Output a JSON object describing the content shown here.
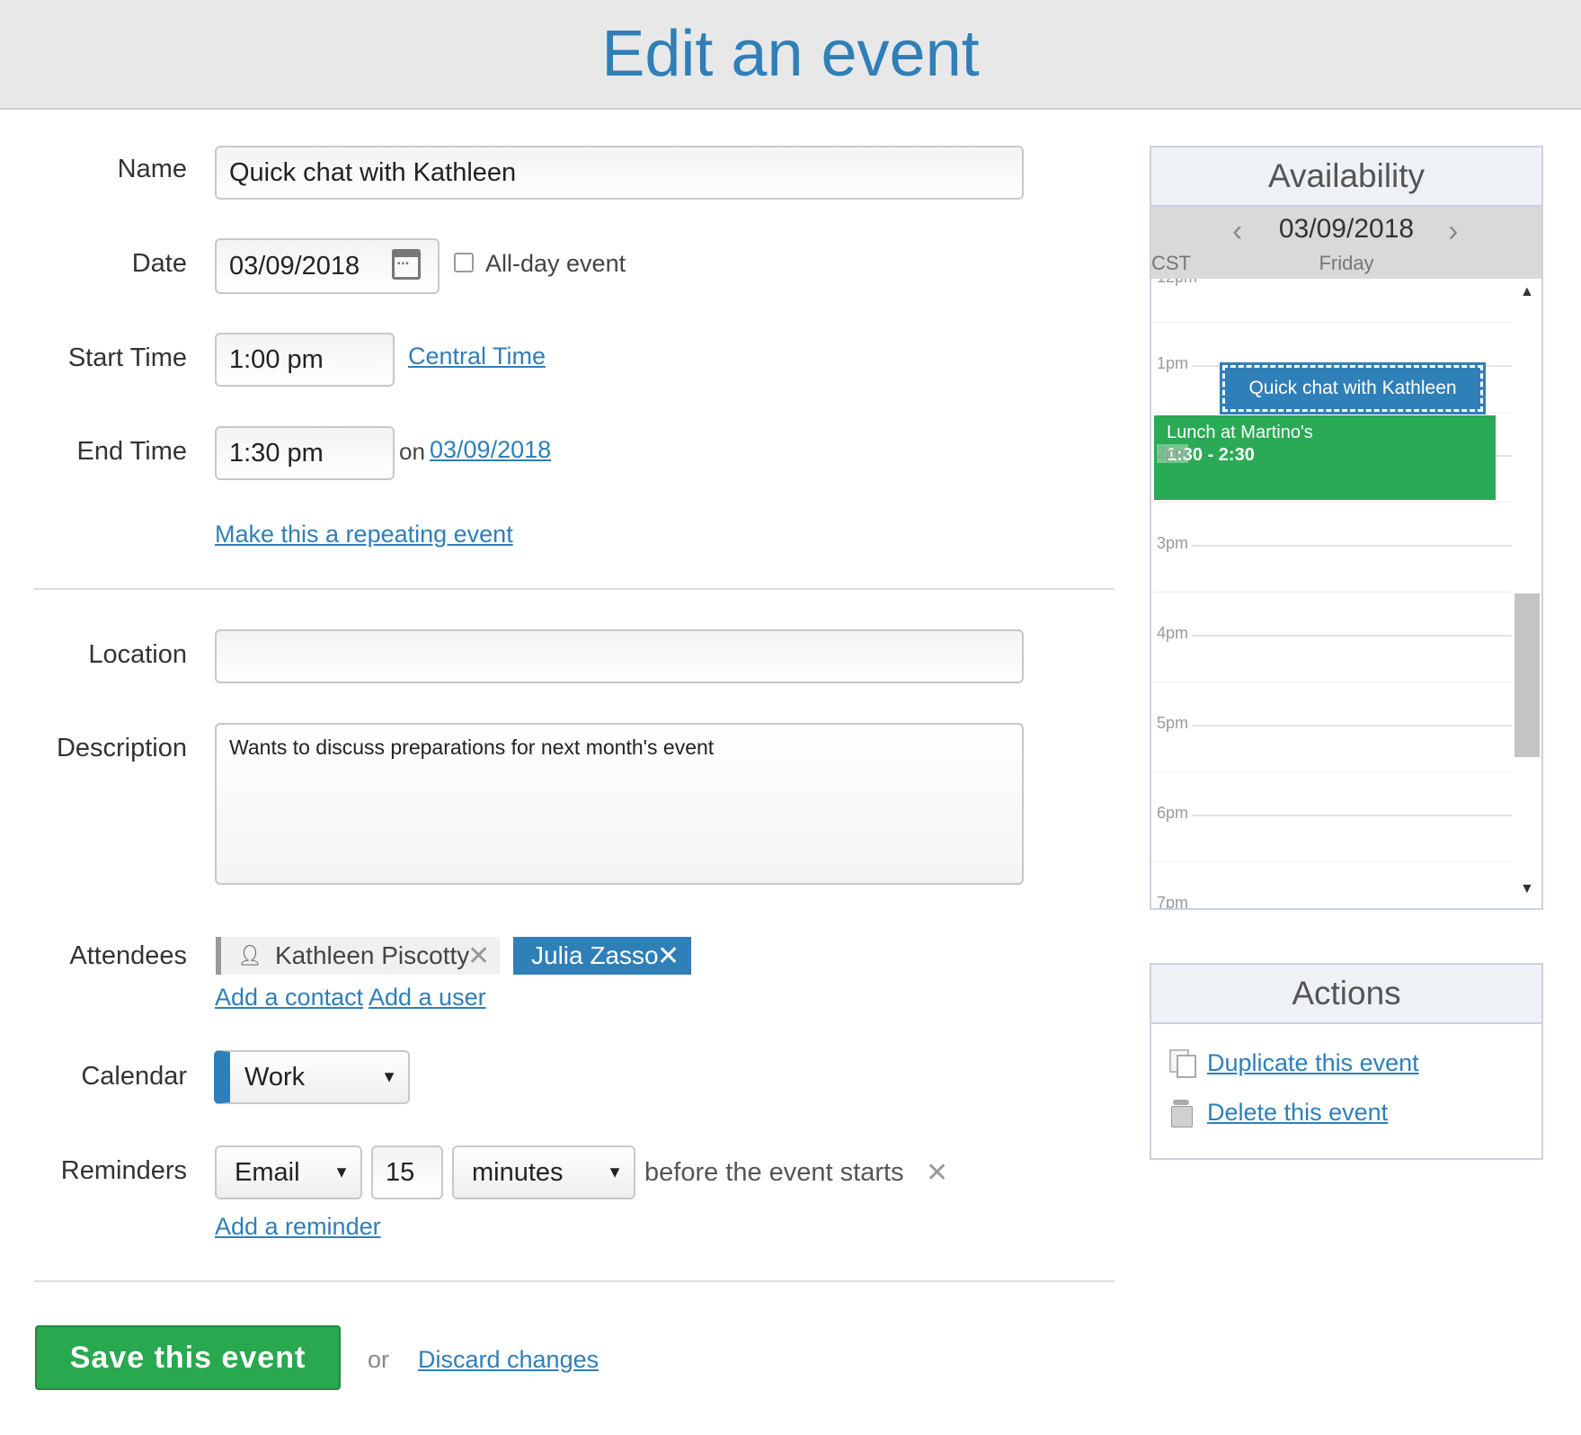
{
  "header": {
    "title": "Edit an event"
  },
  "form": {
    "name_label": "Name",
    "name_value": "Quick chat with Kathleen",
    "date_label": "Date",
    "date_value": "03/09/2018",
    "allday_label": "All-day event",
    "allday_checked": false,
    "start_label": "Start Time",
    "start_value": "1:00 pm",
    "timezone_link": "Central Time",
    "end_label": "End Time",
    "end_value": "1:30 pm",
    "end_on_text": "on",
    "end_date_link": "03/09/2018",
    "repeat_link": "Make this a repeating event",
    "location_label": "Location",
    "location_value": "",
    "description_label": "Description",
    "description_value": "Wants to discuss preparations for next month's event",
    "attendees_label": "Attendees",
    "attendees": [
      {
        "name": "Kathleen Piscotty",
        "type": "contact"
      },
      {
        "name": "Julia Zasso",
        "type": "user"
      }
    ],
    "add_contact_link": "Add a contact",
    "add_user_link": "Add a user",
    "calendar_label": "Calendar",
    "calendar_value": "Work",
    "calendar_color": "#2f7fb8",
    "reminders_label": "Reminders",
    "reminder": {
      "method": "Email",
      "amount": "15",
      "unit": "minutes",
      "suffix": "before the event starts"
    },
    "add_reminder_link": "Add a reminder"
  },
  "footer": {
    "save_label": "Save this event",
    "or_text": "or",
    "discard_link": "Discard changes"
  },
  "availability": {
    "title": "Availability",
    "date": "03/09/2018",
    "timezone": "CST",
    "day": "Friday",
    "hours": [
      "12pm",
      "1pm",
      "2pm",
      "3pm",
      "4pm",
      "5pm",
      "6pm",
      "7pm"
    ],
    "events": [
      {
        "title": "Quick chat with Kathleen",
        "color": "#2f7fb8"
      },
      {
        "title": "Lunch at Martino's",
        "time": "1:30 - 2:30",
        "color": "#2aaa55"
      }
    ]
  },
  "actions": {
    "title": "Actions",
    "duplicate": "Duplicate this event",
    "delete": "Delete this event"
  },
  "colors": {
    "accent": "#2f7fb8",
    "save": "#28a84f"
  }
}
